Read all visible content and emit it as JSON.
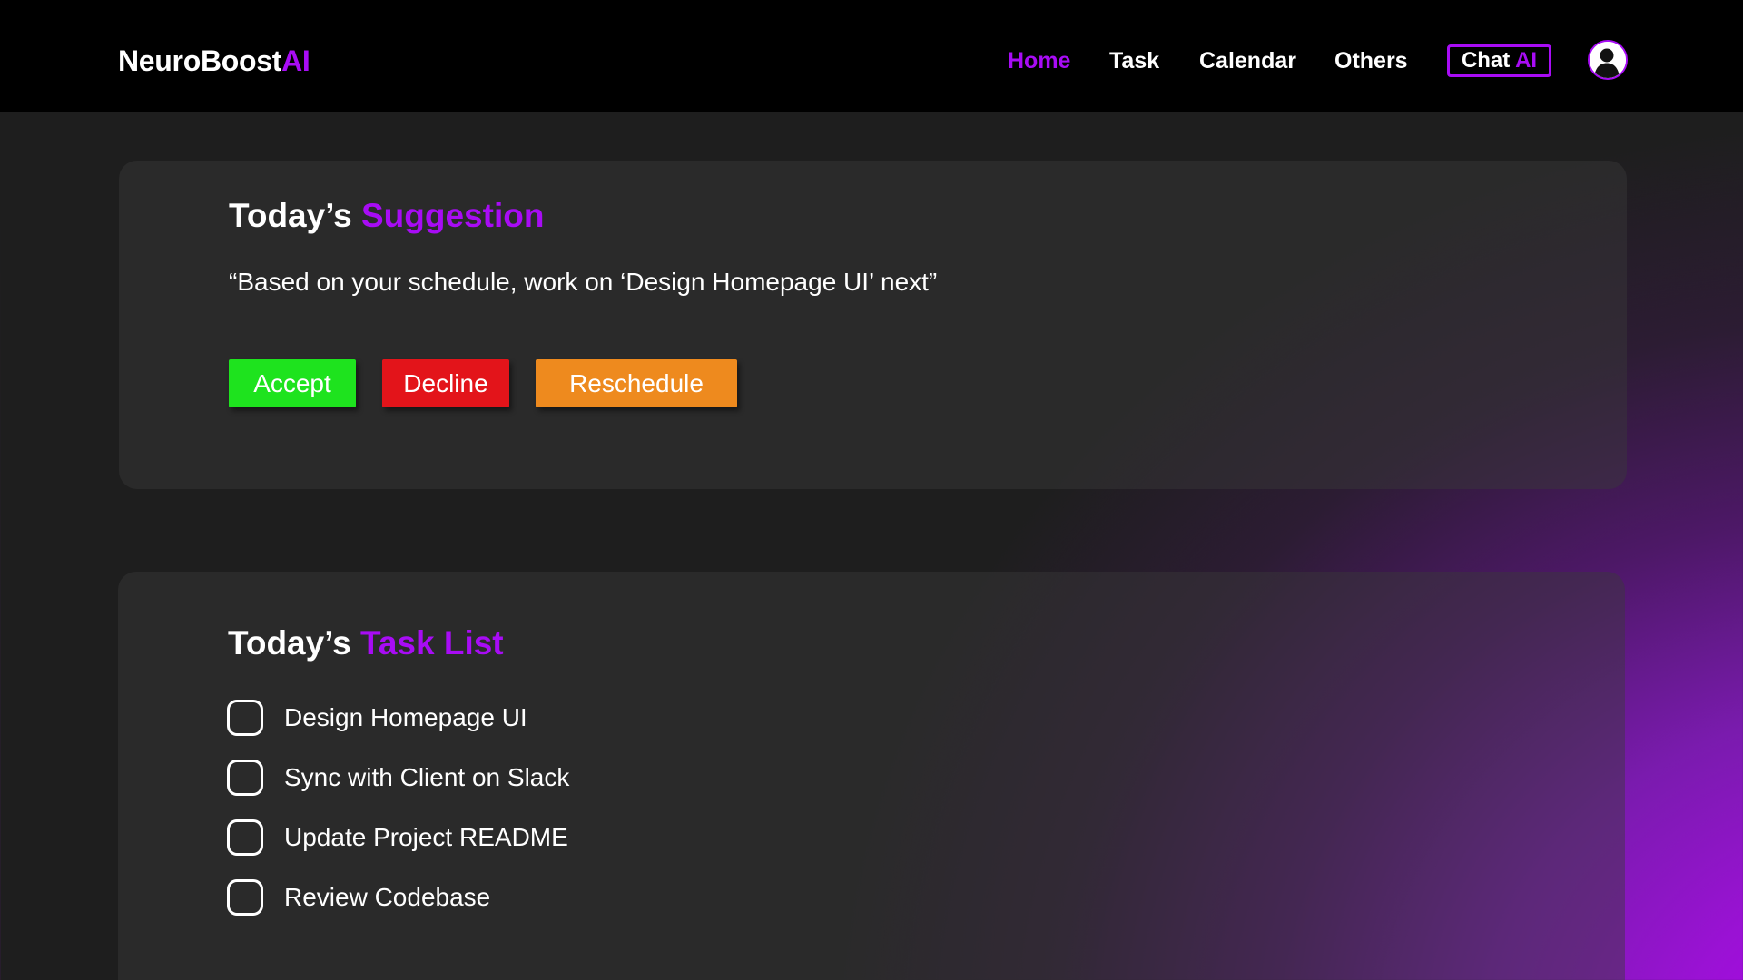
{
  "app": {
    "logo_main": "NeuroBoost",
    "logo_accent": "AI"
  },
  "nav": {
    "items": [
      {
        "label": "Home",
        "active": true
      },
      {
        "label": "Task",
        "active": false
      },
      {
        "label": "Calendar",
        "active": false
      },
      {
        "label": "Others",
        "active": false
      }
    ],
    "chat_label": "Chat",
    "chat_accent": "AI",
    "avatar_icon": "user-avatar-icon"
  },
  "suggestion": {
    "heading_main": "Today’s",
    "heading_accent": "Suggestion",
    "text": "“Based on your schedule, work on ‘Design Homepage UI’ next”",
    "buttons": {
      "accept": "Accept",
      "decline": "Decline",
      "reschedule": "Reschedule"
    }
  },
  "tasks": {
    "heading_main": "Today’s",
    "heading_accent": "Task List",
    "items": [
      {
        "label": "Design Homepage UI",
        "checked": false
      },
      {
        "label": "Sync with Client on Slack",
        "checked": false
      },
      {
        "label": "Update Project README",
        "checked": false
      },
      {
        "label": "Review Codebase",
        "checked": false
      }
    ]
  },
  "colors": {
    "accent": "#a80cf5",
    "accept": "#1ee31e",
    "decline": "#e3141a",
    "reschedule": "#ee8a1e",
    "background": "#1e1e1e",
    "topbar": "#000000"
  }
}
